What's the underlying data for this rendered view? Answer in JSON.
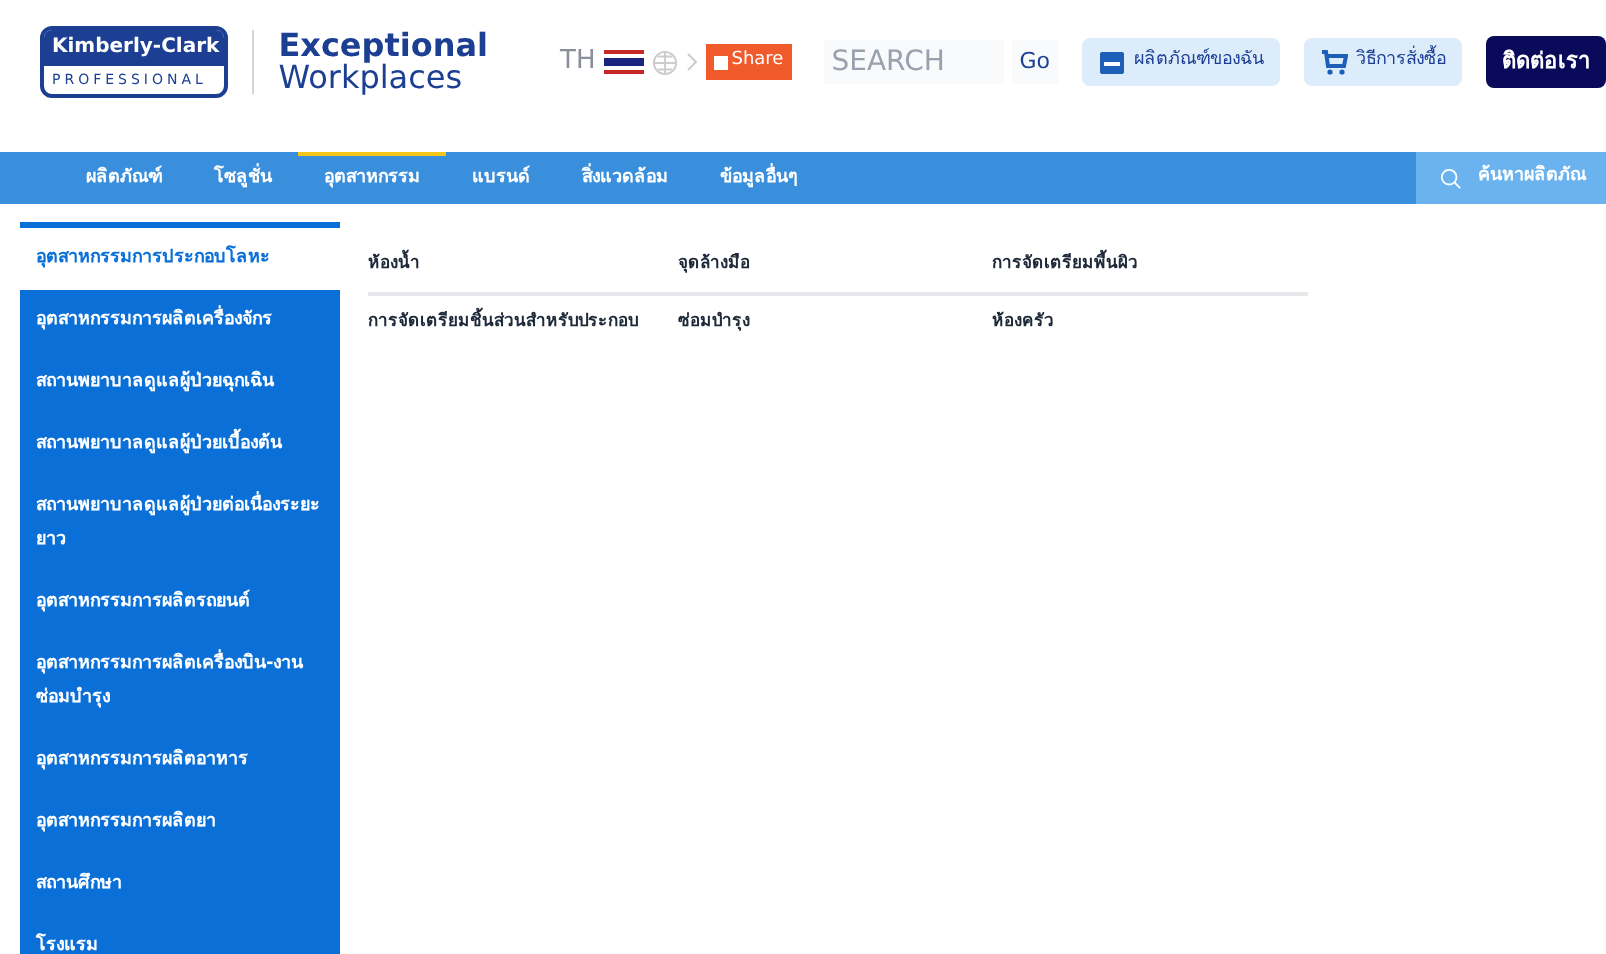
{
  "logo": {
    "brand": "Kimberly-Clark",
    "sub": "PROFESSIONAL",
    "tagline_1": "Exceptional",
    "tagline_2": "Workplaces"
  },
  "header": {
    "language": "TH",
    "share": "Share",
    "search": {
      "placeholder": "SEARCH",
      "button": "Go"
    },
    "my_products": "ผลิตภัณฑ์ของฉัน",
    "how_to_order": "วิธีการสั่งซื้อ",
    "contact": "ติดต่อเรา"
  },
  "nav": {
    "tabs": [
      {
        "label": "ผลิตภัณฑ์",
        "selected": false
      },
      {
        "label": "โซลูชั่น",
        "selected": false
      },
      {
        "label": "อุตสาหกรรม",
        "selected": true
      },
      {
        "label": "แบรนด์",
        "selected": false
      },
      {
        "label": "สิ่งแวดล้อม",
        "selected": false
      },
      {
        "label": "ข้อมูลอื่นๆ",
        "selected": false
      }
    ],
    "search_placeholder": "ค้นหาผลิตภัณ"
  },
  "sidebar": {
    "items": [
      {
        "label": "อุตสาหกรรมการประกอบโลหะ",
        "selected": true
      },
      {
        "label": "อุตสาหกรรมการผลิตเครื่องจักร",
        "selected": false
      },
      {
        "label": "สถานพยาบาลดูแลผู้ป่วยฉุกเฉิน",
        "selected": false
      },
      {
        "label": "สถานพยาบาลดูแลผู้ป่วยเบื้องต้น",
        "selected": false
      },
      {
        "label": "สถานพยาบาลดูแลผู้ป่วยต่อเนื่องระยะยาว",
        "selected": false
      },
      {
        "label": "อุตสาหกรรมการผลิตรถยนต์",
        "selected": false
      },
      {
        "label": "อุตสาหกรรมการผลิตเครื่องบิน-งานซ่อมบำรุง",
        "selected": false
      },
      {
        "label": "อุตสาหกรรมการผลิตอาหาร",
        "selected": false
      },
      {
        "label": "อุตสาหกรรมการผลิตยา",
        "selected": false
      },
      {
        "label": "สถานศึกษา",
        "selected": false
      },
      {
        "label": "โรงแรม",
        "selected": false
      }
    ]
  },
  "solutions": {
    "rows": [
      [
        "ห้องน้ำ",
        "จุดล้างมือ",
        "การจัดเตรียมพื้นผิว"
      ],
      [
        "การจัดเตรียมชิ้นส่วนสำหรับประกอบ",
        "ซ่อมบำรุง",
        "ห้องครัว"
      ]
    ]
  }
}
